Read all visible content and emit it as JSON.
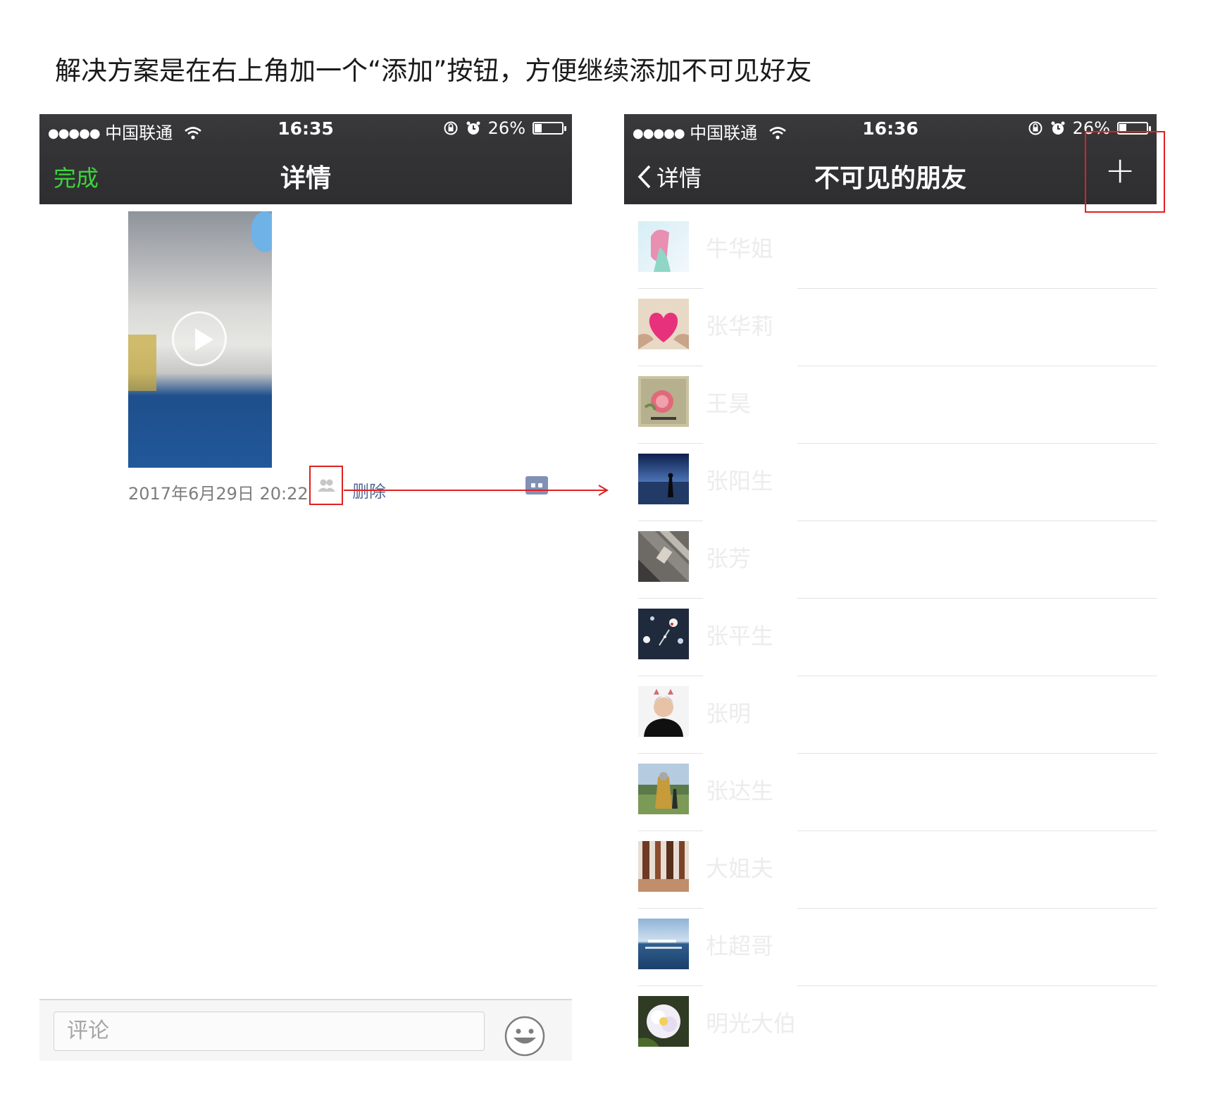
{
  "caption": "解决方案是在右上角加一个“添加”按钮，方便继续添加不可见好友",
  "left_phone": {
    "status": {
      "dots": "●●●●●",
      "carrier": "中国联通",
      "time": "16:35",
      "battery": "26%"
    },
    "nav": {
      "done_label": "完成",
      "title": "详情"
    },
    "post": {
      "timestamp": "2017年6月29日 20:22",
      "delete_label": "删除"
    },
    "comment": {
      "placeholder": "评论"
    }
  },
  "right_phone": {
    "status": {
      "dots": "●●●●●",
      "carrier": "中国联通",
      "time": "16:36",
      "battery": "26%"
    },
    "nav": {
      "back_label": "详情",
      "title": "不可见的朋友",
      "add_label": "+"
    },
    "friends": [
      {
        "name": "牛华姐"
      },
      {
        "name": "张华莉"
      },
      {
        "name": "王昊"
      },
      {
        "name": "张阳生"
      },
      {
        "name": "张芳"
      },
      {
        "name": "张平生"
      },
      {
        "name": "张明"
      },
      {
        "name": "张达生"
      },
      {
        "name": "大姐夫"
      },
      {
        "name": "杜超哥"
      },
      {
        "name": "明光大伯"
      }
    ]
  },
  "colors": {
    "accent_green": "#3dd33d",
    "link_blue": "#576b95",
    "annotation_red": "#e02020",
    "navbar": "#343436"
  },
  "battery_level": 0.26
}
